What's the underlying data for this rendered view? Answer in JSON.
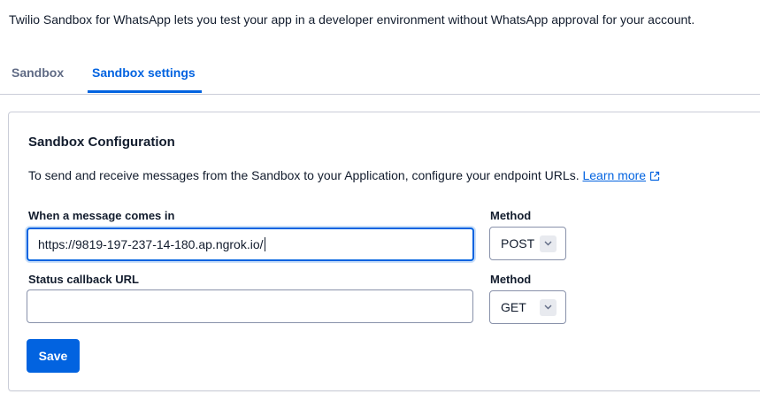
{
  "intro": "Twilio Sandbox for WhatsApp lets you test your app in a developer environment without WhatsApp approval for your account.",
  "tabs": [
    {
      "label": "Sandbox",
      "active": false
    },
    {
      "label": "Sandbox settings",
      "active": true
    }
  ],
  "config": {
    "title": "Sandbox Configuration",
    "description": "To send and receive messages from the Sandbox to your Application, configure your endpoint URLs.",
    "learn_more": "Learn more",
    "incoming": {
      "label": "When a message comes in",
      "value": "https://9819-197-237-14-180.ap.ngrok.io/",
      "method_label": "Method",
      "method_value": "POST"
    },
    "status_callback": {
      "label": "Status callback URL",
      "value": "",
      "method_label": "Method",
      "method_value": "GET"
    },
    "save_label": "Save"
  },
  "colors": {
    "accent": "#0263e0",
    "text": "#121c2d",
    "muted": "#606b85",
    "border": "#8891aa"
  },
  "icons": [
    "external-link-icon",
    "chevron-down-icon"
  ]
}
